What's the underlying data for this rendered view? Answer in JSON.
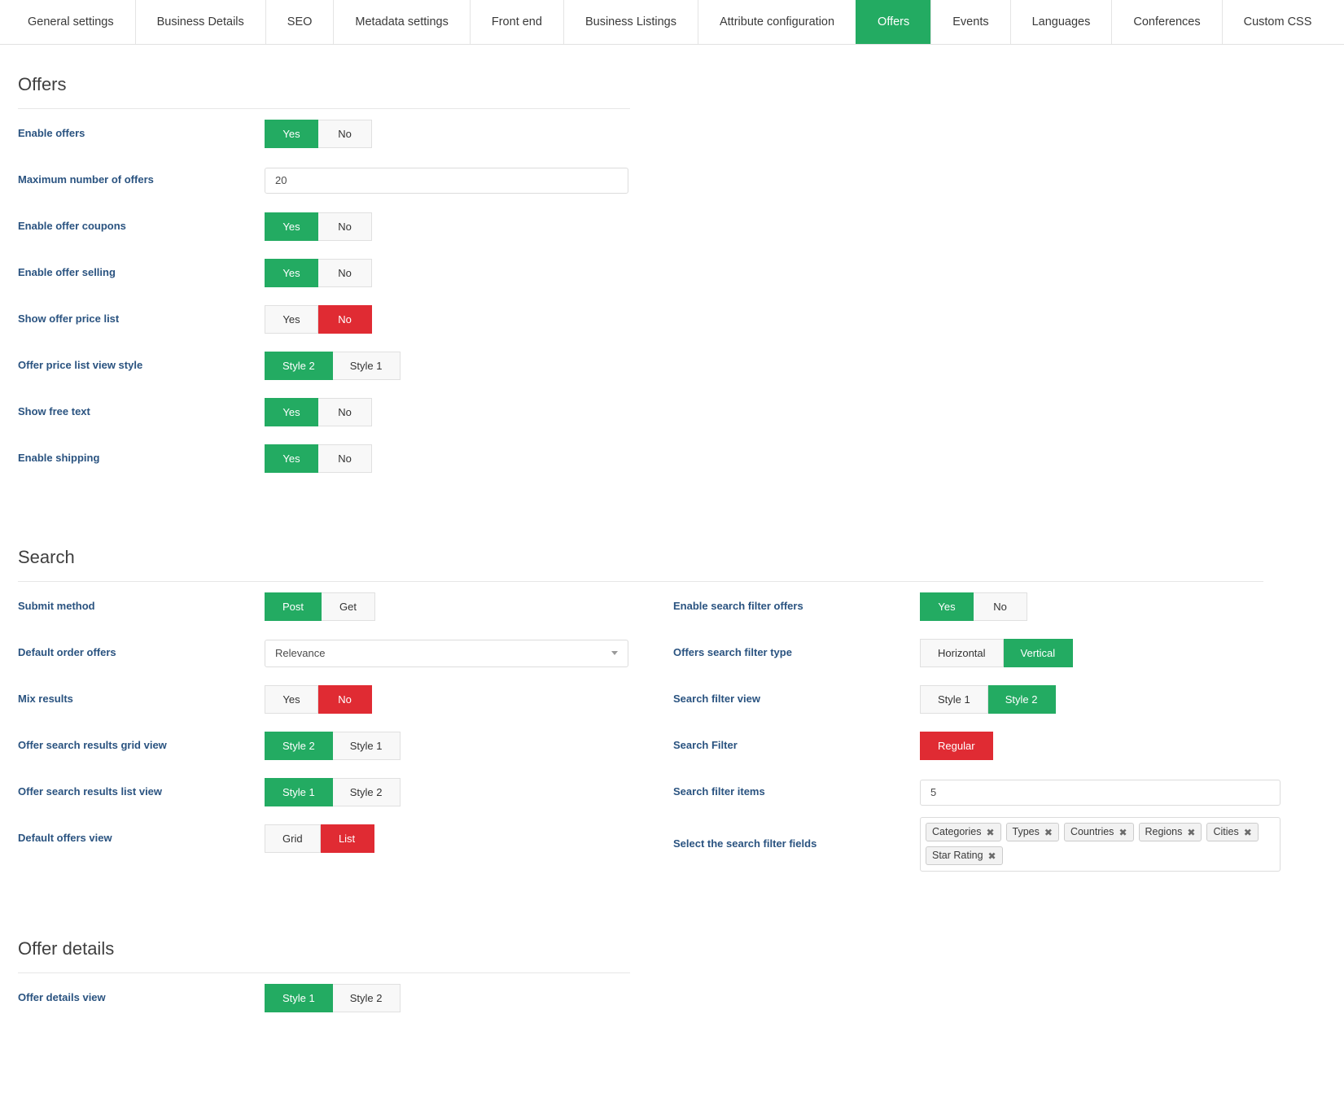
{
  "tabs": [
    {
      "label": "General settings",
      "active": false
    },
    {
      "label": "Business Details",
      "active": false
    },
    {
      "label": "SEO",
      "active": false
    },
    {
      "label": "Metadata settings",
      "active": false
    },
    {
      "label": "Front end",
      "active": false
    },
    {
      "label": "Business Listings",
      "active": false
    },
    {
      "label": "Attribute configuration",
      "active": false
    },
    {
      "label": "Offers",
      "active": true
    },
    {
      "label": "Events",
      "active": false
    },
    {
      "label": "Languages",
      "active": false
    },
    {
      "label": "Conferences",
      "active": false
    },
    {
      "label": "Custom CSS",
      "active": false
    }
  ],
  "colors": {
    "accent_green": "#23ab62",
    "accent_red": "#e02b33",
    "label_blue": "#2a5380"
  },
  "offers": {
    "title": "Offers",
    "rows": {
      "enable_offers": {
        "label": "Enable offers",
        "yes": "Yes",
        "no": "No"
      },
      "maximum_number_of_offers": {
        "label": "Maximum number of offers",
        "value": "20"
      },
      "enable_offer_coupons": {
        "label": "Enable offer coupons",
        "yes": "Yes",
        "no": "No"
      },
      "enable_offer_selling": {
        "label": "Enable offer selling",
        "yes": "Yes",
        "no": "No"
      },
      "show_offer_price_list": {
        "label": "Show offer price list",
        "yes": "Yes",
        "no": "No"
      },
      "offer_price_list_view_style": {
        "label": "Offer price list view style",
        "opt1": "Style 2",
        "opt2": "Style 1"
      },
      "show_free_text": {
        "label": "Show free text",
        "yes": "Yes",
        "no": "No"
      },
      "enable_shipping": {
        "label": "Enable shipping",
        "yes": "Yes",
        "no": "No"
      }
    }
  },
  "search": {
    "title": "Search",
    "left": {
      "submit_method": {
        "label": "Submit method",
        "opt1": "Post",
        "opt2": "Get"
      },
      "default_order_offers": {
        "label": "Default order offers",
        "value": "Relevance"
      },
      "mix_results": {
        "label": "Mix results",
        "yes": "Yes",
        "no": "No"
      },
      "offer_search_results_grid_view": {
        "label": "Offer search results grid view",
        "opt1": "Style 2",
        "opt2": "Style 1"
      },
      "offer_search_results_list_view": {
        "label": "Offer search results list view",
        "opt1": "Style 1",
        "opt2": "Style 2"
      },
      "default_offers_view": {
        "label": "Default offers view",
        "opt1": "Grid",
        "opt2": "List"
      }
    },
    "right": {
      "enable_search_filter_offers": {
        "label": "Enable search filter offers",
        "yes": "Yes",
        "no": "No"
      },
      "offers_search_filter_type": {
        "label": "Offers search filter type",
        "opt1": "Horizontal",
        "opt2": "Vertical"
      },
      "search_filter_view": {
        "label": "Search filter view",
        "opt1": "Style 1",
        "opt2": "Style 2"
      },
      "search_filter": {
        "label": "Search Filter",
        "value": "Regular"
      },
      "search_filter_items": {
        "label": "Search filter items",
        "value": "5"
      },
      "select_search_filter_fields": {
        "label": "Select the search filter fields",
        "chips": [
          "Categories",
          "Types",
          "Countries",
          "Regions",
          "Cities",
          "Star Rating"
        ],
        "remove_glyph": "✖"
      }
    }
  },
  "offer_details": {
    "title": "Offer details",
    "rows": {
      "offer_details_view": {
        "label": "Offer details view",
        "opt1": "Style 1",
        "opt2": "Style 2"
      }
    }
  }
}
